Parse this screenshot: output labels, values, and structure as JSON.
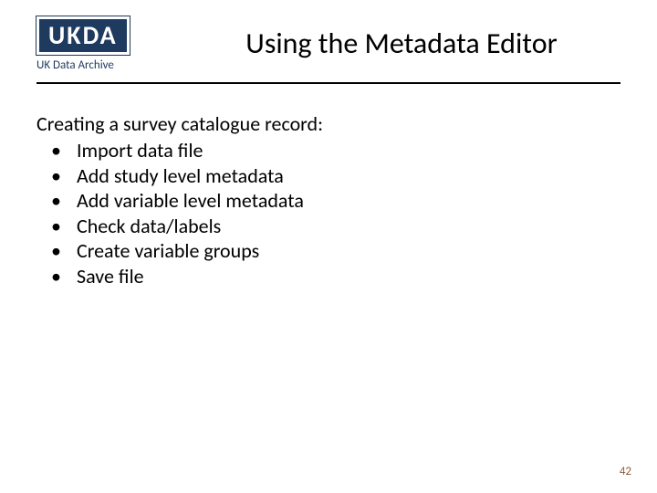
{
  "logo": {
    "name": "UKDA",
    "subtitle": "UK Data Archive"
  },
  "title": "Using the Metadata Editor",
  "intro": "Creating a survey catalogue record:",
  "bullets": [
    "Import data file",
    "Add study level metadata",
    "Add variable level metadata",
    "Check data/labels",
    "Create variable groups",
    "Save file"
  ],
  "page_number": "42"
}
